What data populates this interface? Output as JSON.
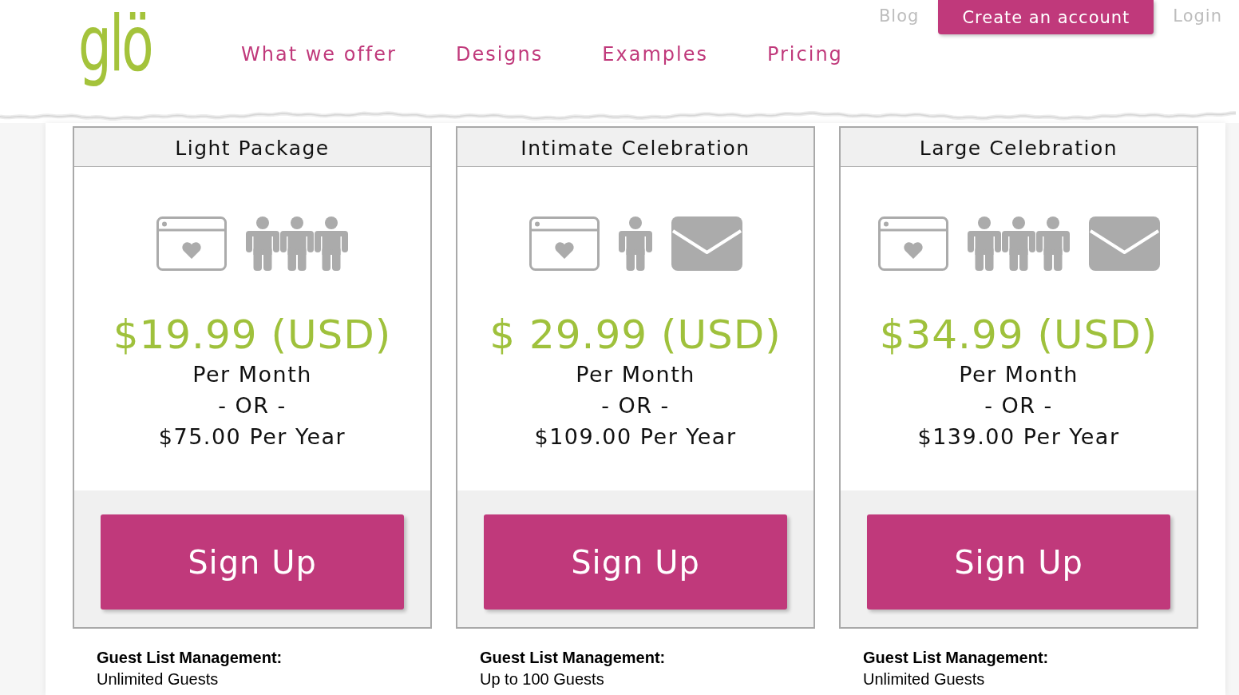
{
  "header": {
    "logo": "glö",
    "nav": [
      {
        "label": "What we offer"
      },
      {
        "label": "Designs"
      },
      {
        "label": "Examples"
      },
      {
        "label": "Pricing"
      }
    ],
    "utility_links": [
      {
        "kind": "link",
        "label": "Blog"
      },
      {
        "kind": "button",
        "label": "Create an account"
      },
      {
        "kind": "link",
        "label": "Login"
      }
    ]
  },
  "plans": [
    {
      "title": "Light Package",
      "icons": [
        {
          "kind": "website"
        },
        {
          "kind": "group"
        }
      ],
      "price": "$19.99 (USD)",
      "terms": [
        "Per Month",
        "- OR -",
        "$75.00 Per Year"
      ],
      "button": "Sign Up",
      "features": [
        {
          "heading": "Guest List Management:",
          "value": "Unlimited Guests"
        }
      ]
    },
    {
      "title": "Intimate Celebration",
      "icons": [
        {
          "kind": "website"
        },
        {
          "kind": "person"
        },
        {
          "kind": "envelope"
        }
      ],
      "price": "$ 29.99 (USD)",
      "terms": [
        "Per Month",
        "- OR -",
        "$109.00 Per Year"
      ],
      "button": "Sign Up",
      "features": [
        {
          "heading": "Guest List Management:",
          "value": "Up to 100 Guests"
        }
      ]
    },
    {
      "title": "Large Celebration",
      "icons": [
        {
          "kind": "website"
        },
        {
          "kind": "group"
        },
        {
          "kind": "envelope"
        }
      ],
      "price": "$34.99 (USD)",
      "terms": [
        "Per Month",
        "- OR -",
        "$139.00 Per Year"
      ],
      "button": "Sign Up",
      "features": [
        {
          "heading": "Guest List Management:",
          "value": "Unlimited Guests"
        }
      ]
    }
  ]
}
